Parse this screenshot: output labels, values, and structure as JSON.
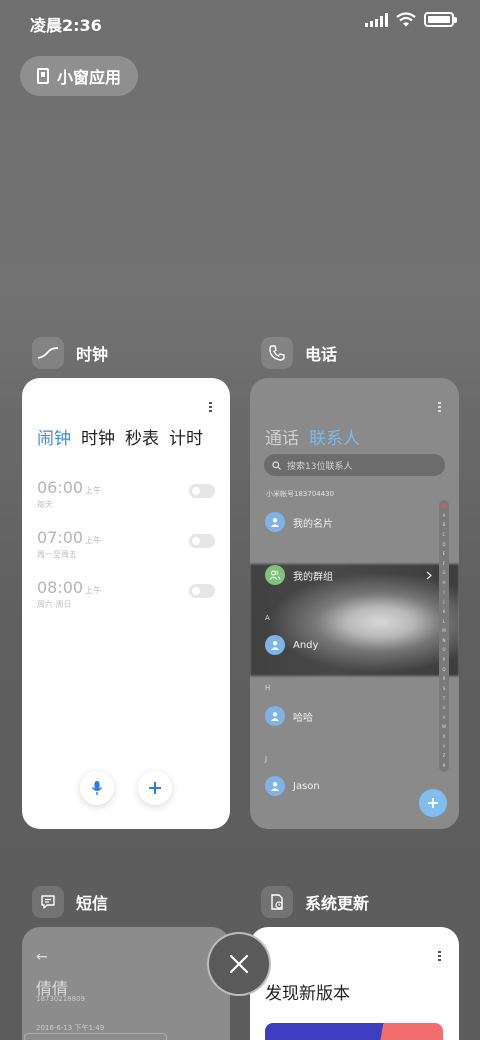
{
  "status_bar": {
    "time": "凌晨2:36",
    "icons": [
      "signal-icon",
      "wifi-icon",
      "battery-icon"
    ]
  },
  "floating_window_button": {
    "label": "小窗应用",
    "icon": "floating-window-icon"
  },
  "cards": {
    "clock": {
      "app_name": "时钟",
      "tabs": [
        "闹钟",
        "时钟",
        "秒表",
        "计时"
      ],
      "active_tab": "闹钟",
      "alarms": [
        {
          "time": "06:00",
          "ampm": "上午",
          "repeat": "每天",
          "enabled": false
        },
        {
          "time": "07:00",
          "ampm": "上午",
          "repeat": "周一至周五",
          "enabled": false
        },
        {
          "time": "08:00",
          "ampm": "上午",
          "repeat": "周六 周日",
          "enabled": false
        }
      ]
    },
    "phone": {
      "app_name": "电话",
      "tabs": [
        "通话",
        "联系人"
      ],
      "active_tab": "联系人",
      "search_placeholder": "搜索13位联系人",
      "account": "小米帐号183704430",
      "my_card": "我的名片",
      "my_groups": "我的群组",
      "sections": [
        {
          "letter": "A",
          "contact": "Andy"
        },
        {
          "letter": "H",
          "contact": "哈哈"
        },
        {
          "letter": "J",
          "contact": "Jason"
        }
      ],
      "index_letters": [
        "A",
        "B",
        "C",
        "D",
        "E",
        "F",
        "G",
        "H",
        "I",
        "J",
        "K",
        "L",
        "M",
        "N",
        "O",
        "P",
        "Q",
        "R",
        "S",
        "T",
        "U",
        "V",
        "W",
        "X",
        "Y",
        "Z",
        "#"
      ]
    },
    "sms": {
      "app_name": "短信",
      "contact_name": "倩倩",
      "contact_number": "18730218809",
      "date": "2016-6-13 下午1:49"
    },
    "update": {
      "app_name": "系统更新",
      "title": "发现新版本"
    }
  },
  "colors": {
    "accent_blue": "#3a8ee6",
    "phone_accent": "#7fb8ec",
    "group_green": "#7fc27a"
  }
}
